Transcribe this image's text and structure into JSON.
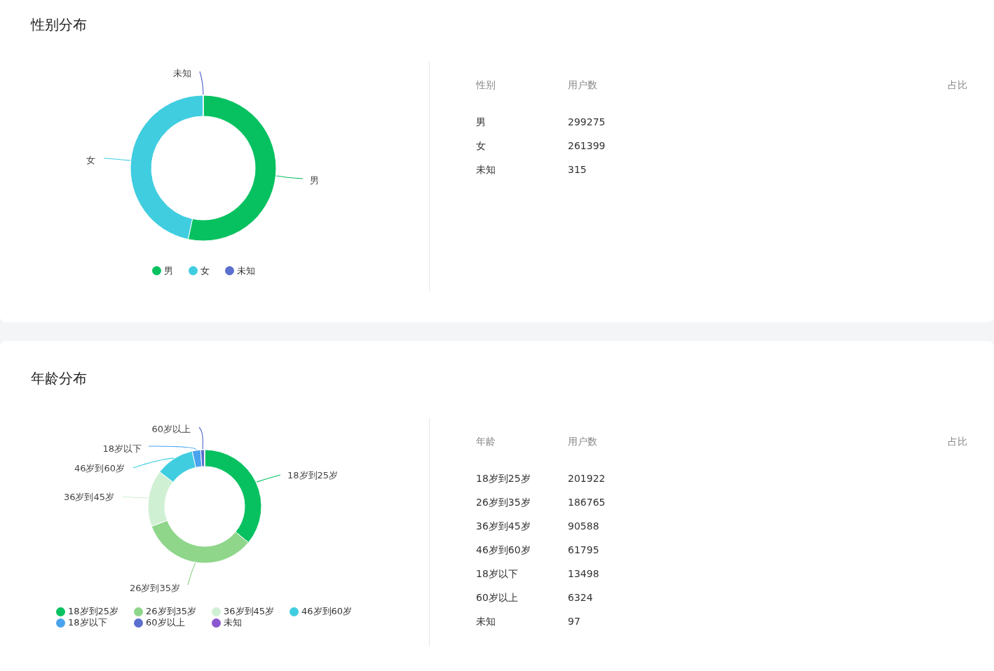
{
  "sections": [
    {
      "title": "性别分布",
      "donut": {
        "slice_labels": [
          "男",
          "女",
          "未知"
        ]
      },
      "legend": [
        {
          "label": "男",
          "color": "#07c160"
        },
        {
          "label": "女",
          "color": "#40cde0"
        },
        {
          "label": "未知",
          "color": "#5b6fcf"
        }
      ],
      "table": {
        "columns": [
          "性别",
          "用户数",
          "占比"
        ],
        "rows": [
          [
            "男",
            "299275"
          ],
          [
            "女",
            "261399"
          ],
          [
            "未知",
            "315"
          ]
        ]
      }
    },
    {
      "title": "年龄分布",
      "donut": {
        "slice_labels": [
          "60岁以上",
          "18岁以下",
          "46岁到60岁",
          "18岁到25岁",
          "36岁到45岁",
          "26岁到35岁"
        ]
      },
      "legend": [
        {
          "label": "18岁到25岁",
          "color": "#07c160"
        },
        {
          "label": "26岁到35岁",
          "color": "#8fd68b"
        },
        {
          "label": "36岁到45岁",
          "color": "#d0f0d4"
        },
        {
          "label": "46岁到60岁",
          "color": "#40cde0"
        },
        {
          "label": "18岁以下",
          "color": "#4aa3ee"
        },
        {
          "label": "60岁以上",
          "color": "#5b6fcf"
        },
        {
          "label": "未知",
          "color": "#8b57cf"
        }
      ],
      "table": {
        "columns": [
          "年龄",
          "用户数",
          "占比"
        ],
        "rows": [
          [
            "18岁到25岁",
            "201922"
          ],
          [
            "26岁到35岁",
            "186765"
          ],
          [
            "36岁到45岁",
            "90588"
          ],
          [
            "46岁到60岁",
            "61795"
          ],
          [
            "18岁以下",
            "13498"
          ],
          [
            "60岁以上",
            "6324"
          ],
          [
            "未知",
            "97"
          ]
        ]
      }
    }
  ]
}
